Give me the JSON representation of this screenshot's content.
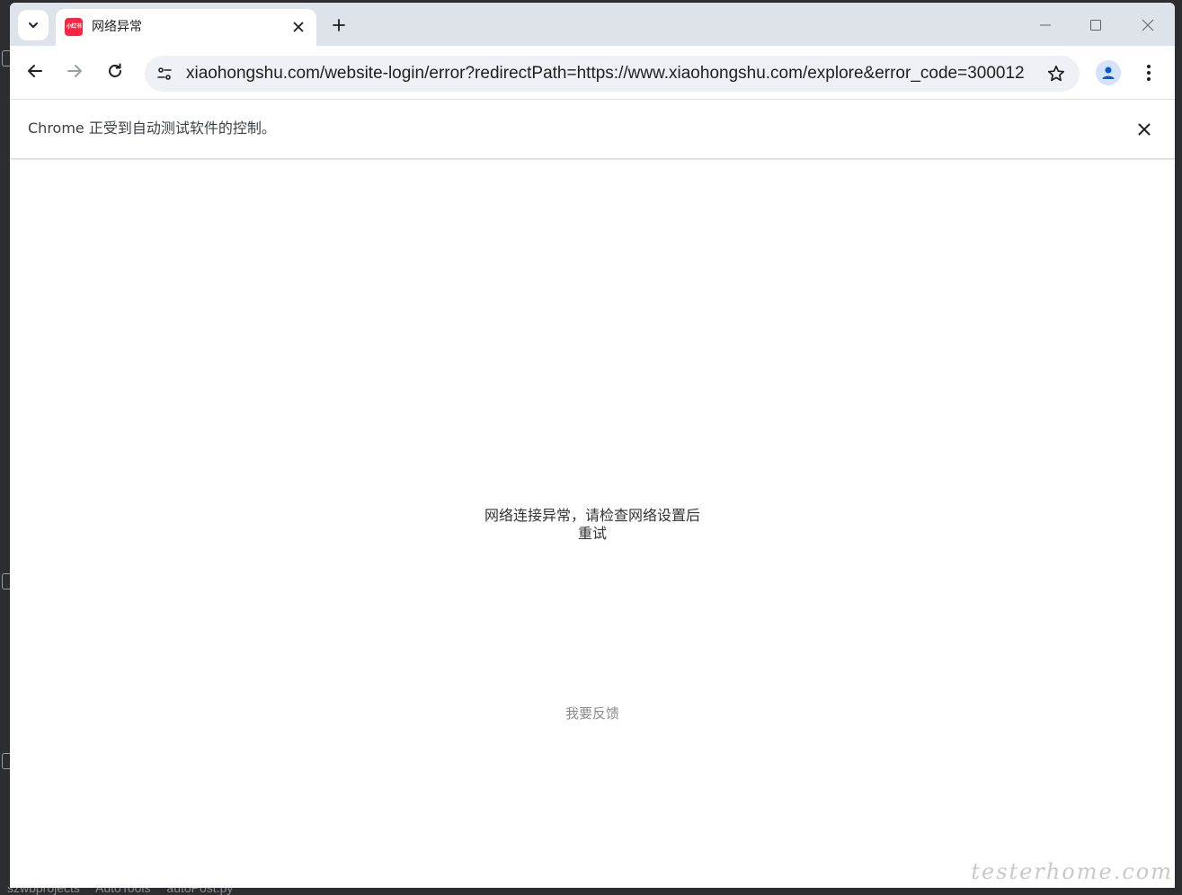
{
  "tab": {
    "title": "网络异常",
    "favicon_text": "小红书"
  },
  "address_bar": {
    "url": "xiaohongshu.com/website-login/error?redirectPath=https://www.xiaohongshu.com/explore&error_code=300012"
  },
  "infobar": {
    "message": "Chrome 正受到自动测试软件的控制。"
  },
  "page": {
    "error_message": "网络连接异常，请检查网络设置后重试",
    "feedback_link": "我要反馈"
  },
  "ide": {
    "breadcrumbs": [
      "szwbprojects",
      "AutoTools",
      "autoPost.py"
    ]
  },
  "watermark": "testerhome.com",
  "colors": {
    "tabstrip_bg": "#dee3ea",
    "omnibox_bg": "#edf0f4",
    "favicon_brand": "#ff2442",
    "profile_accent": "#0b57d0"
  },
  "icons": [
    "tab-search-icon",
    "close-icon",
    "plus-icon",
    "minimize-icon",
    "maximize-icon",
    "back-icon",
    "forward-icon",
    "reload-icon",
    "tune-icon",
    "star-icon",
    "profile-icon",
    "more-vert-icon"
  ]
}
